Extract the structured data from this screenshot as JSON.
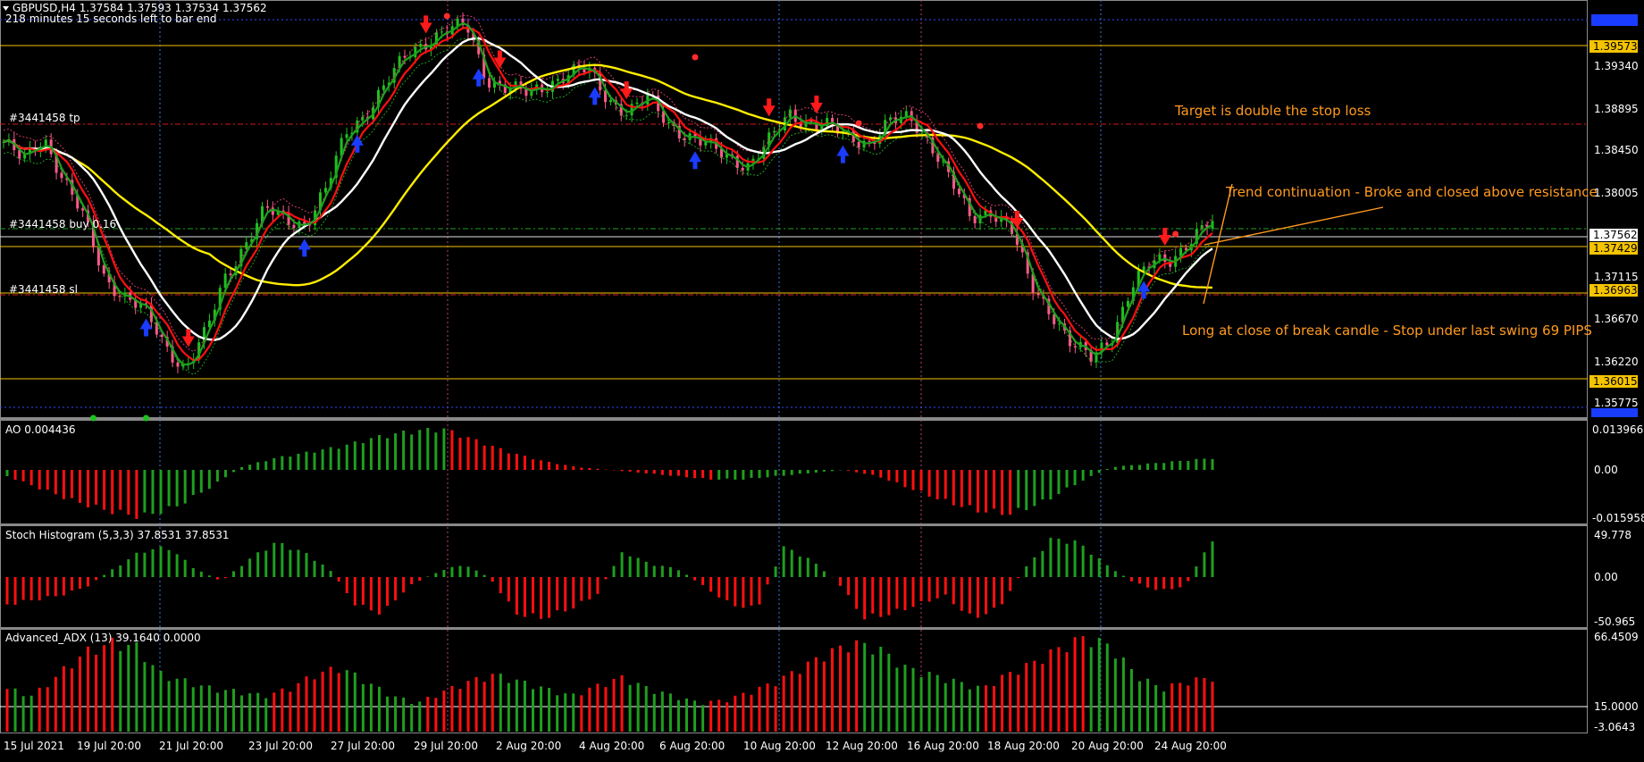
{
  "header": {
    "symbol_line": "GBPUSD,H4  1.37584 1.37593 1.37534 1.37562",
    "timer": "218 minutes 15 seconds left to bar end"
  },
  "main": {
    "order_labels": {
      "tp": "#3441458 tp",
      "entry": "#3441458 buy 0.16",
      "sl": "#3441458 sl"
    },
    "y_ticks": [
      "1.39340",
      "1.38895",
      "1.38450",
      "1.38005",
      "1.37115",
      "1.36670",
      "1.36220",
      "1.35775"
    ],
    "price_tags": [
      {
        "text": "1.39573",
        "bg": "#f5c400",
        "fg": "#000000"
      },
      {
        "text": "1.37562",
        "bg": "#ffffff",
        "fg": "#000000"
      },
      {
        "text": "1.37429",
        "bg": "#f5c400",
        "fg": "#000000"
      },
      {
        "text": "1.36963",
        "bg": "#f5c400",
        "fg": "#000000"
      },
      {
        "text": "1.36015",
        "bg": "#f5c400",
        "fg": "#000000"
      }
    ],
    "annotations": {
      "target": "Target is double the stop loss",
      "trend": "Trend continuation - Broke and closed above resistance",
      "entry": "Long at close of break candle - Stop under last swing 69 PIPS"
    }
  },
  "x_labels": [
    "15 Jul 2021",
    "19 Jul 20:00",
    "21 Jul 20:00",
    "23 Jul 20:00",
    "27 Jul 20:00",
    "29 Jul 20:00",
    "2 Aug 20:00",
    "4 Aug 20:00",
    "6 Aug 20:00",
    "10 Aug 20:00",
    "12 Aug 20:00",
    "16 Aug 20:00",
    "18 Aug 20:00",
    "20 Aug 20:00",
    "24 Aug 20:00"
  ],
  "ao": {
    "label": "AO 0.004436",
    "ticks": [
      "0.013966",
      "0.00",
      "-0.015958"
    ]
  },
  "stoch": {
    "label": "Stoch Histogram (5,3,3) 37.8531 37.8531",
    "ticks": [
      "49.778",
      "0.00",
      "-50.965"
    ]
  },
  "adx": {
    "label": "Advanced_ADX (13) 39.1640 0.0000",
    "ticks": [
      "66.4509",
      "15.0000",
      "-3.0643"
    ]
  },
  "colors": {
    "bull": "#1fc01f",
    "bear": "#ff5a8a",
    "up_arrow": "#1a3cff",
    "down_arrow": "#ff1a1a",
    "ma_yellow": "#ffee00",
    "ma_white": "#ffffff",
    "ma_red": "#ff1010",
    "ma_green": "#1f9f1f",
    "annot": "#ff9a1f",
    "hist_up": "#1f9f1f",
    "hist_down": "#ff1010"
  },
  "chart_data": {
    "type": "candlestick",
    "ylim": [
      1.3555,
      1.3985
    ],
    "closes": [
      1.384,
      1.382,
      1.3845,
      1.38,
      1.376,
      1.37,
      1.368,
      1.3665,
      1.363,
      1.3605,
      1.364,
      1.37,
      1.3735,
      1.377,
      1.376,
      1.3755,
      1.379,
      1.385,
      1.387,
      1.39,
      1.393,
      1.3945,
      1.3955,
      1.396,
      1.3905,
      1.3895,
      1.389,
      1.39,
      1.391,
      1.3915,
      1.3885,
      1.387,
      1.3885,
      1.386,
      1.3845,
      1.3835,
      1.3825,
      1.3815,
      1.384,
      1.387,
      1.386,
      1.3855,
      1.3845,
      1.384,
      1.386,
      1.3865,
      1.384,
      1.38,
      1.376,
      1.377,
      1.375,
      1.369,
      1.3665,
      1.363,
      1.3615,
      1.364,
      1.369,
      1.3715,
      1.372,
      1.374,
      1.3756
    ],
    "ao": [
      -0.002,
      -0.006,
      -0.01,
      -0.013,
      -0.015,
      -0.012,
      -0.006,
      0.001,
      0.004,
      0.006,
      0.008,
      0.011,
      0.013,
      0.014,
      0.01,
      0.006,
      0.003,
      0.001,
      0.0,
      -0.001,
      -0.002,
      -0.003,
      -0.003,
      -0.002,
      -0.001,
      0.0,
      -0.002,
      -0.006,
      -0.01,
      -0.013,
      -0.014,
      -0.01,
      -0.004,
      0.001,
      0.002,
      0.003,
      0.004
    ],
    "stoch": [
      -30,
      -25,
      -20,
      -10,
      10,
      30,
      35,
      10,
      -5,
      20,
      40,
      30,
      10,
      -30,
      -40,
      -10,
      5,
      15,
      0,
      -40,
      -45,
      -35,
      -20,
      30,
      15,
      10,
      -10,
      -30,
      -35,
      35,
      20,
      -5,
      -45,
      -40,
      -30,
      -20,
      -45,
      -35,
      10,
      45,
      40,
      15,
      -5,
      -15,
      -10,
      45
    ],
    "adx": [
      30,
      25,
      40,
      55,
      62,
      60,
      40,
      35,
      30,
      28,
      25,
      30,
      40,
      45,
      35,
      25,
      20,
      28,
      35,
      40,
      35,
      30,
      25,
      32,
      38,
      30,
      25,
      20,
      22,
      28,
      35,
      45,
      55,
      62,
      58,
      45,
      40,
      35,
      30,
      40,
      48,
      58,
      66,
      60,
      40,
      30,
      35,
      38
    ]
  }
}
